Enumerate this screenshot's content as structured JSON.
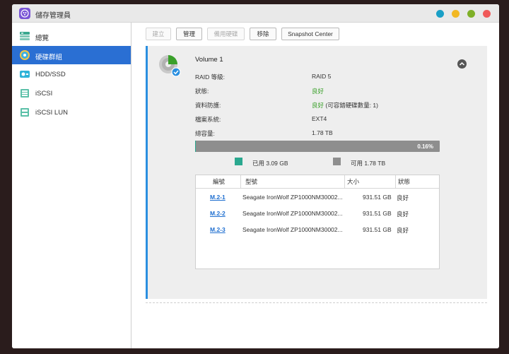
{
  "window": {
    "title": "儲存管理員",
    "controls": [
      {
        "name": "info",
        "color": "#1a9fc6"
      },
      {
        "name": "minimize",
        "color": "#f2b824"
      },
      {
        "name": "maximize",
        "color": "#7fb028"
      },
      {
        "name": "close",
        "color": "#f05a5a"
      }
    ]
  },
  "sidebar": {
    "items": [
      {
        "id": "overview",
        "label": "總覽",
        "icon": "overview-icon",
        "active": false
      },
      {
        "id": "disk-groups",
        "label": "硬碟群組",
        "icon": "disk-group-icon",
        "active": true
      },
      {
        "id": "hdd-ssd",
        "label": "HDD/SSD",
        "icon": "hdd-icon",
        "active": false
      },
      {
        "id": "iscsi",
        "label": "iSCSI",
        "icon": "iscsi-icon",
        "active": false
      },
      {
        "id": "iscsi-lun",
        "label": "iSCSI LUN",
        "icon": "iscsi-lun-icon",
        "active": false
      }
    ]
  },
  "toolbar": {
    "create": "建立",
    "manage": "管理",
    "hot_spare": "備用硬碟",
    "remove": "移除",
    "snapshot": "Snapshot Center"
  },
  "volume": {
    "title": "Volume 1",
    "fields": [
      {
        "label": "RAID 等級:",
        "value": "RAID 5"
      },
      {
        "label": "狀態:",
        "value": "良好"
      },
      {
        "label": "資料防護:",
        "value": "良好",
        "extra": " (可容錯硬碟數量: 1)"
      },
      {
        "label": "檔案系統:",
        "value": "EXT4"
      },
      {
        "label": "總容量:",
        "value": "1.78 TB"
      }
    ],
    "usage_fraction": 0.0016,
    "usage_label": "0.16%",
    "used_label": "已用 3.09 GB",
    "free_label": "可用 1.78 TB",
    "used_color": "#2aa88f",
    "free_color": "#8e8e8e"
  },
  "disks": {
    "columns": [
      "編號",
      "型號",
      "大小",
      "狀態"
    ],
    "rows": [
      {
        "id": "M.2-1",
        "model": "Seagate IronWolf ZP1000NM30002...",
        "size": "931.51 GB",
        "status": "良好"
      },
      {
        "id": "M.2-2",
        "model": "Seagate IronWolf ZP1000NM30002...",
        "size": "931.51 GB",
        "status": "良好"
      },
      {
        "id": "M.2-3",
        "model": "Seagate IronWolf ZP1000NM30002...",
        "size": "931.51 GB",
        "status": "良好"
      }
    ]
  }
}
